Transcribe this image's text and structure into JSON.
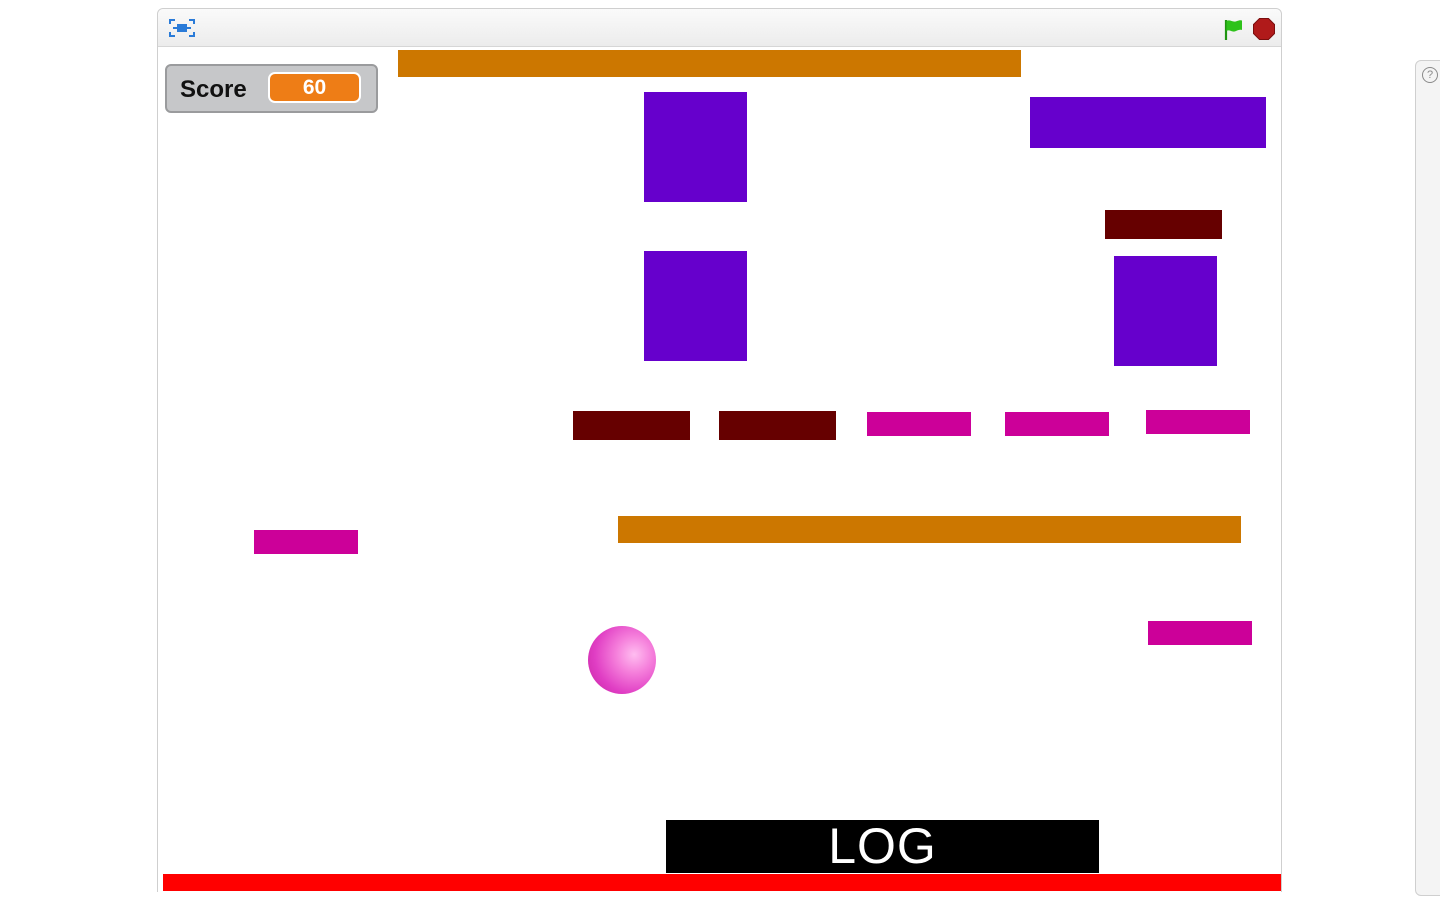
{
  "toolbar": {
    "fullscreen_icon": "fullscreen-icon",
    "green_flag_icon": "green-flag-icon",
    "stop_icon": "stop-sign-icon",
    "flag_color": "#2ec21a",
    "stop_color": "#b01a1a"
  },
  "score_monitor": {
    "label": "Score",
    "value": "60"
  },
  "log": {
    "text": "LOG"
  },
  "colors": {
    "orange_bar": "#cc7700",
    "purple_block": "#6600cc",
    "dark_red_brick": "#660000",
    "magenta_brick": "#cc0099",
    "floor": "#ff0000",
    "score_badge": "#ee7d16"
  },
  "side_panel": {
    "help_icon": "help-icon",
    "help_glyph": "?"
  }
}
